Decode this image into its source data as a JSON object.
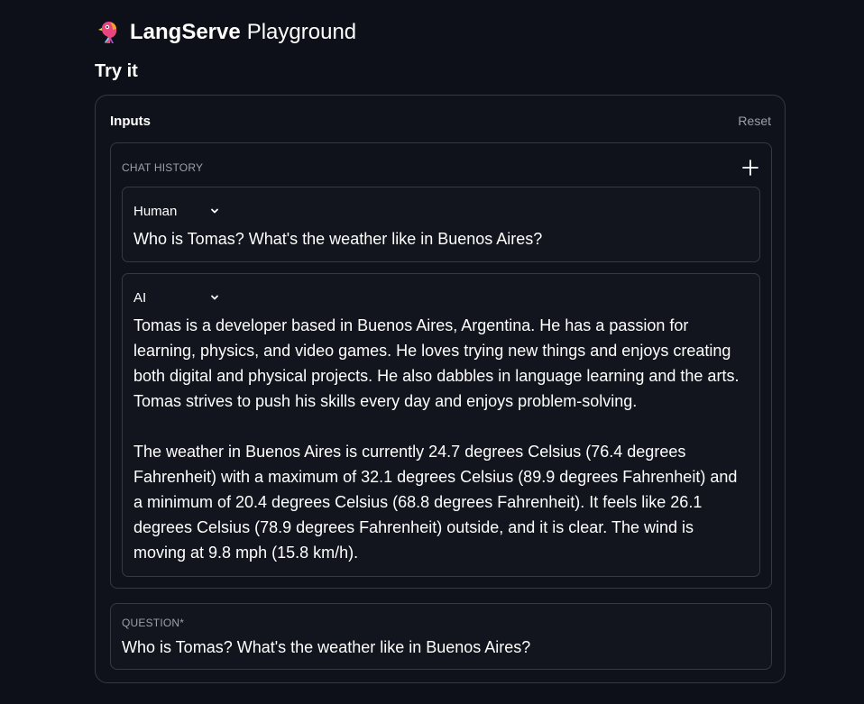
{
  "header": {
    "brand_bold": "LangServe",
    "brand_light": "Playground",
    "logo_icon": "parrot-logo"
  },
  "section_title": "Try it",
  "inputs": {
    "label": "Inputs",
    "reset_label": "Reset",
    "chat_history": {
      "label": "CHAT HISTORY",
      "add_icon": "plus-icon",
      "messages": [
        {
          "role": "Human",
          "content": "Who is Tomas? What's the weather like in Buenos Aires?"
        },
        {
          "role": "AI",
          "content": "Tomas is a developer based in Buenos Aires, Argentina. He has a passion for learning, physics, and video games. He loves trying new things and enjoys creating both digital and physical projects. He also dabbles in language learning and the arts. Tomas strives to push his skills every day and enjoys problem-solving.\n\nThe weather in Buenos Aires is currently 24.7 degrees Celsius (76.4 degrees Fahrenheit) with a maximum of 32.1 degrees Celsius (89.9 degrees Fahrenheit) and a minimum of 20.4 degrees Celsius (68.8 degrees Fahrenheit). It feels like 26.1 degrees Celsius (78.9 degrees Fahrenheit) outside, and it is clear. The wind is moving at 9.8 mph (15.8 km/h)."
        }
      ]
    },
    "question": {
      "label": "QUESTION*",
      "value": "Who is Tomas? What's the weather like in Buenos Aires?"
    }
  },
  "colors": {
    "background": "#0d1018",
    "border": "#343945",
    "muted_text": "#9aa0ab",
    "text": "#ffffff"
  }
}
